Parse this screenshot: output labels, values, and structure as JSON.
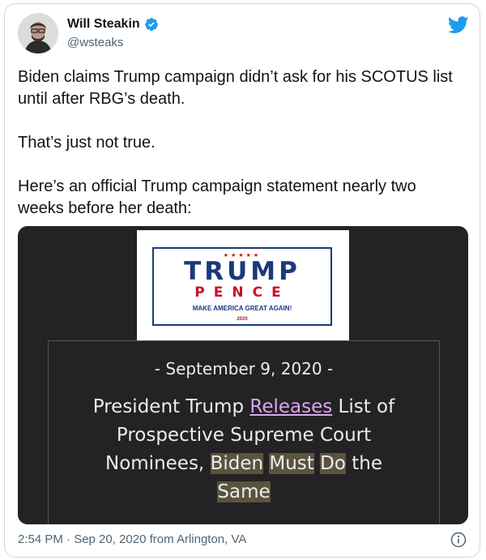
{
  "author": {
    "name": "Will Steakin",
    "handle": "@wsteaks",
    "verified": true
  },
  "tweet": {
    "paragraphs": [
      "Biden claims Trump campaign didn’t ask for his SCOTUS list\nuntil after RBG’s death.",
      "That’s just not true.",
      "Here’s an official Trump campaign statement nearly two\nweeks before her death:"
    ]
  },
  "media": {
    "logo": {
      "stars": "★★★★★",
      "line1": "TRUMP",
      "line2": "PENCE",
      "line3": "MAKE AMERICA GREAT AGAIN!",
      "line4": "2020"
    },
    "statement": {
      "date": "- September 9, 2020 -",
      "headline": {
        "part1": "President Trump ",
        "link": "Releases",
        "part2": " List of",
        "line2": "Prospective Supreme Court",
        "line3_start": "Nominees, ",
        "hl1": "Biden",
        "hl2": "Must",
        "hl3": "Do",
        "line3_end": " the",
        "hl4": "Same"
      }
    }
  },
  "meta": {
    "timestamp": "2:54 PM · Sep 20, 2020 from Arlington, VA"
  },
  "colors": {
    "verified": "#1d9bf0",
    "twitter": "#1d9bf0",
    "media_bg": "#232325",
    "link": "#d9a6ec",
    "highlight": "#5a543d"
  },
  "icons": [
    "avatar",
    "verified-badge-icon",
    "twitter-bird-icon",
    "info-icon"
  ]
}
